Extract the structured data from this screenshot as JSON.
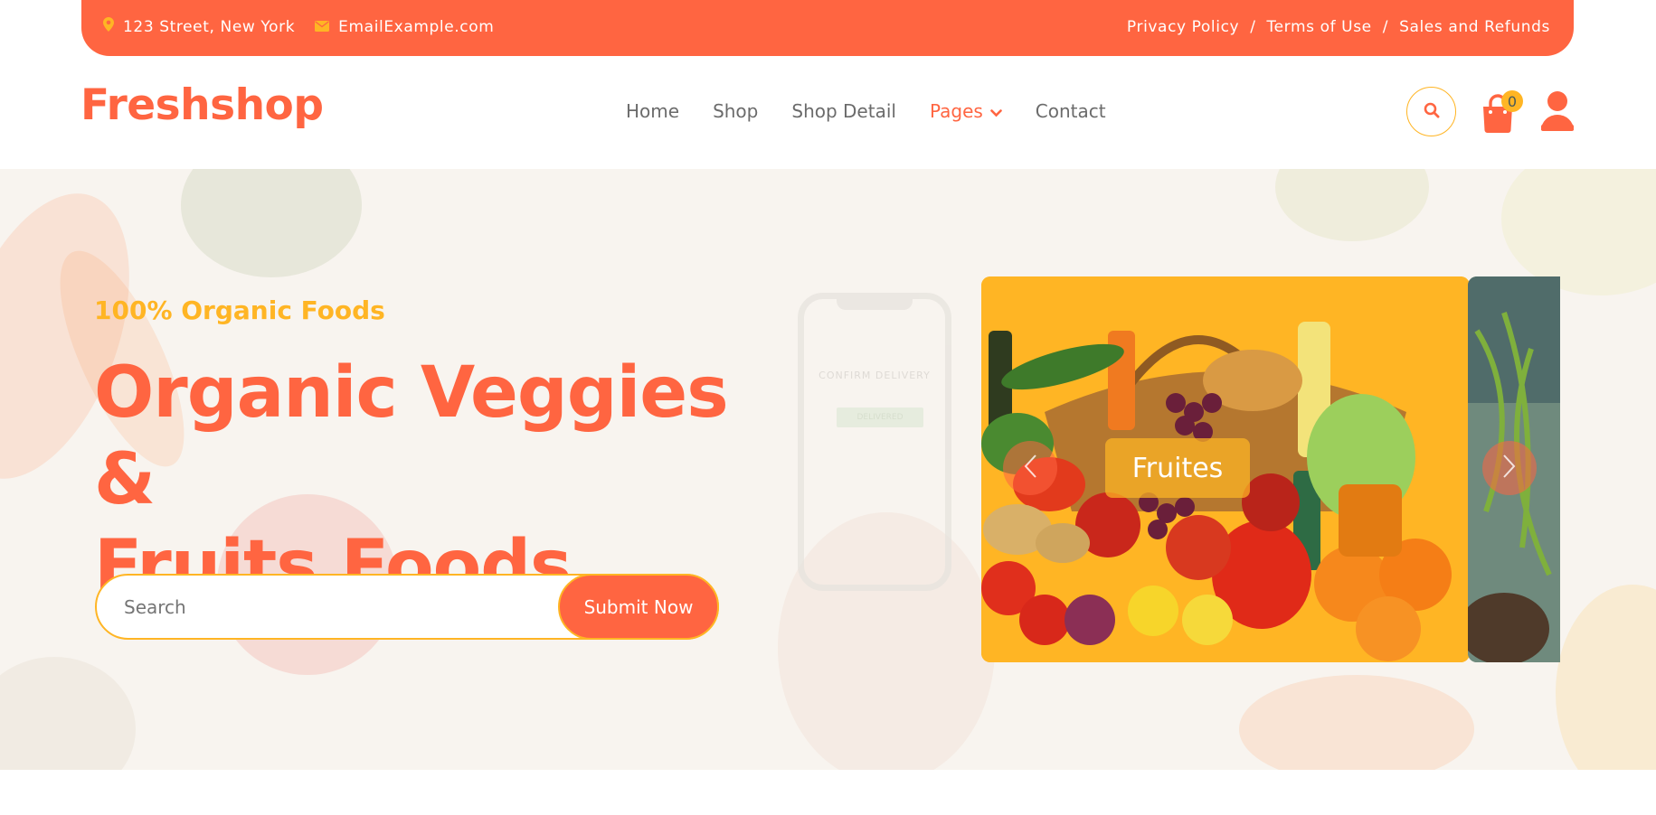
{
  "topbar": {
    "address": "123 Street, New York",
    "email": "EmailExample.com",
    "links": [
      "Privacy Policy",
      "Terms of Use",
      "Sales and Refunds"
    ],
    "separator": "/"
  },
  "header": {
    "logo": "Freshshop",
    "nav": [
      "Home",
      "Shop",
      "Shop Detail",
      "Pages",
      "Contact"
    ],
    "active_nav": "Pages",
    "cart_count": "0"
  },
  "hero": {
    "subtitle": "100% Organic Foods",
    "title_line1": "Organic Veggies &",
    "title_line2": "Fruits Foods",
    "search_placeholder": "Search",
    "submit_label": "Submit Now",
    "phone_text": "CONFIRM DELIVERY",
    "phone_button": "DELIVERED",
    "carousel_caption": "Fruites"
  },
  "colors": {
    "primary": "#ff6541",
    "secondary": "#ffb524",
    "text": "#45595b"
  }
}
